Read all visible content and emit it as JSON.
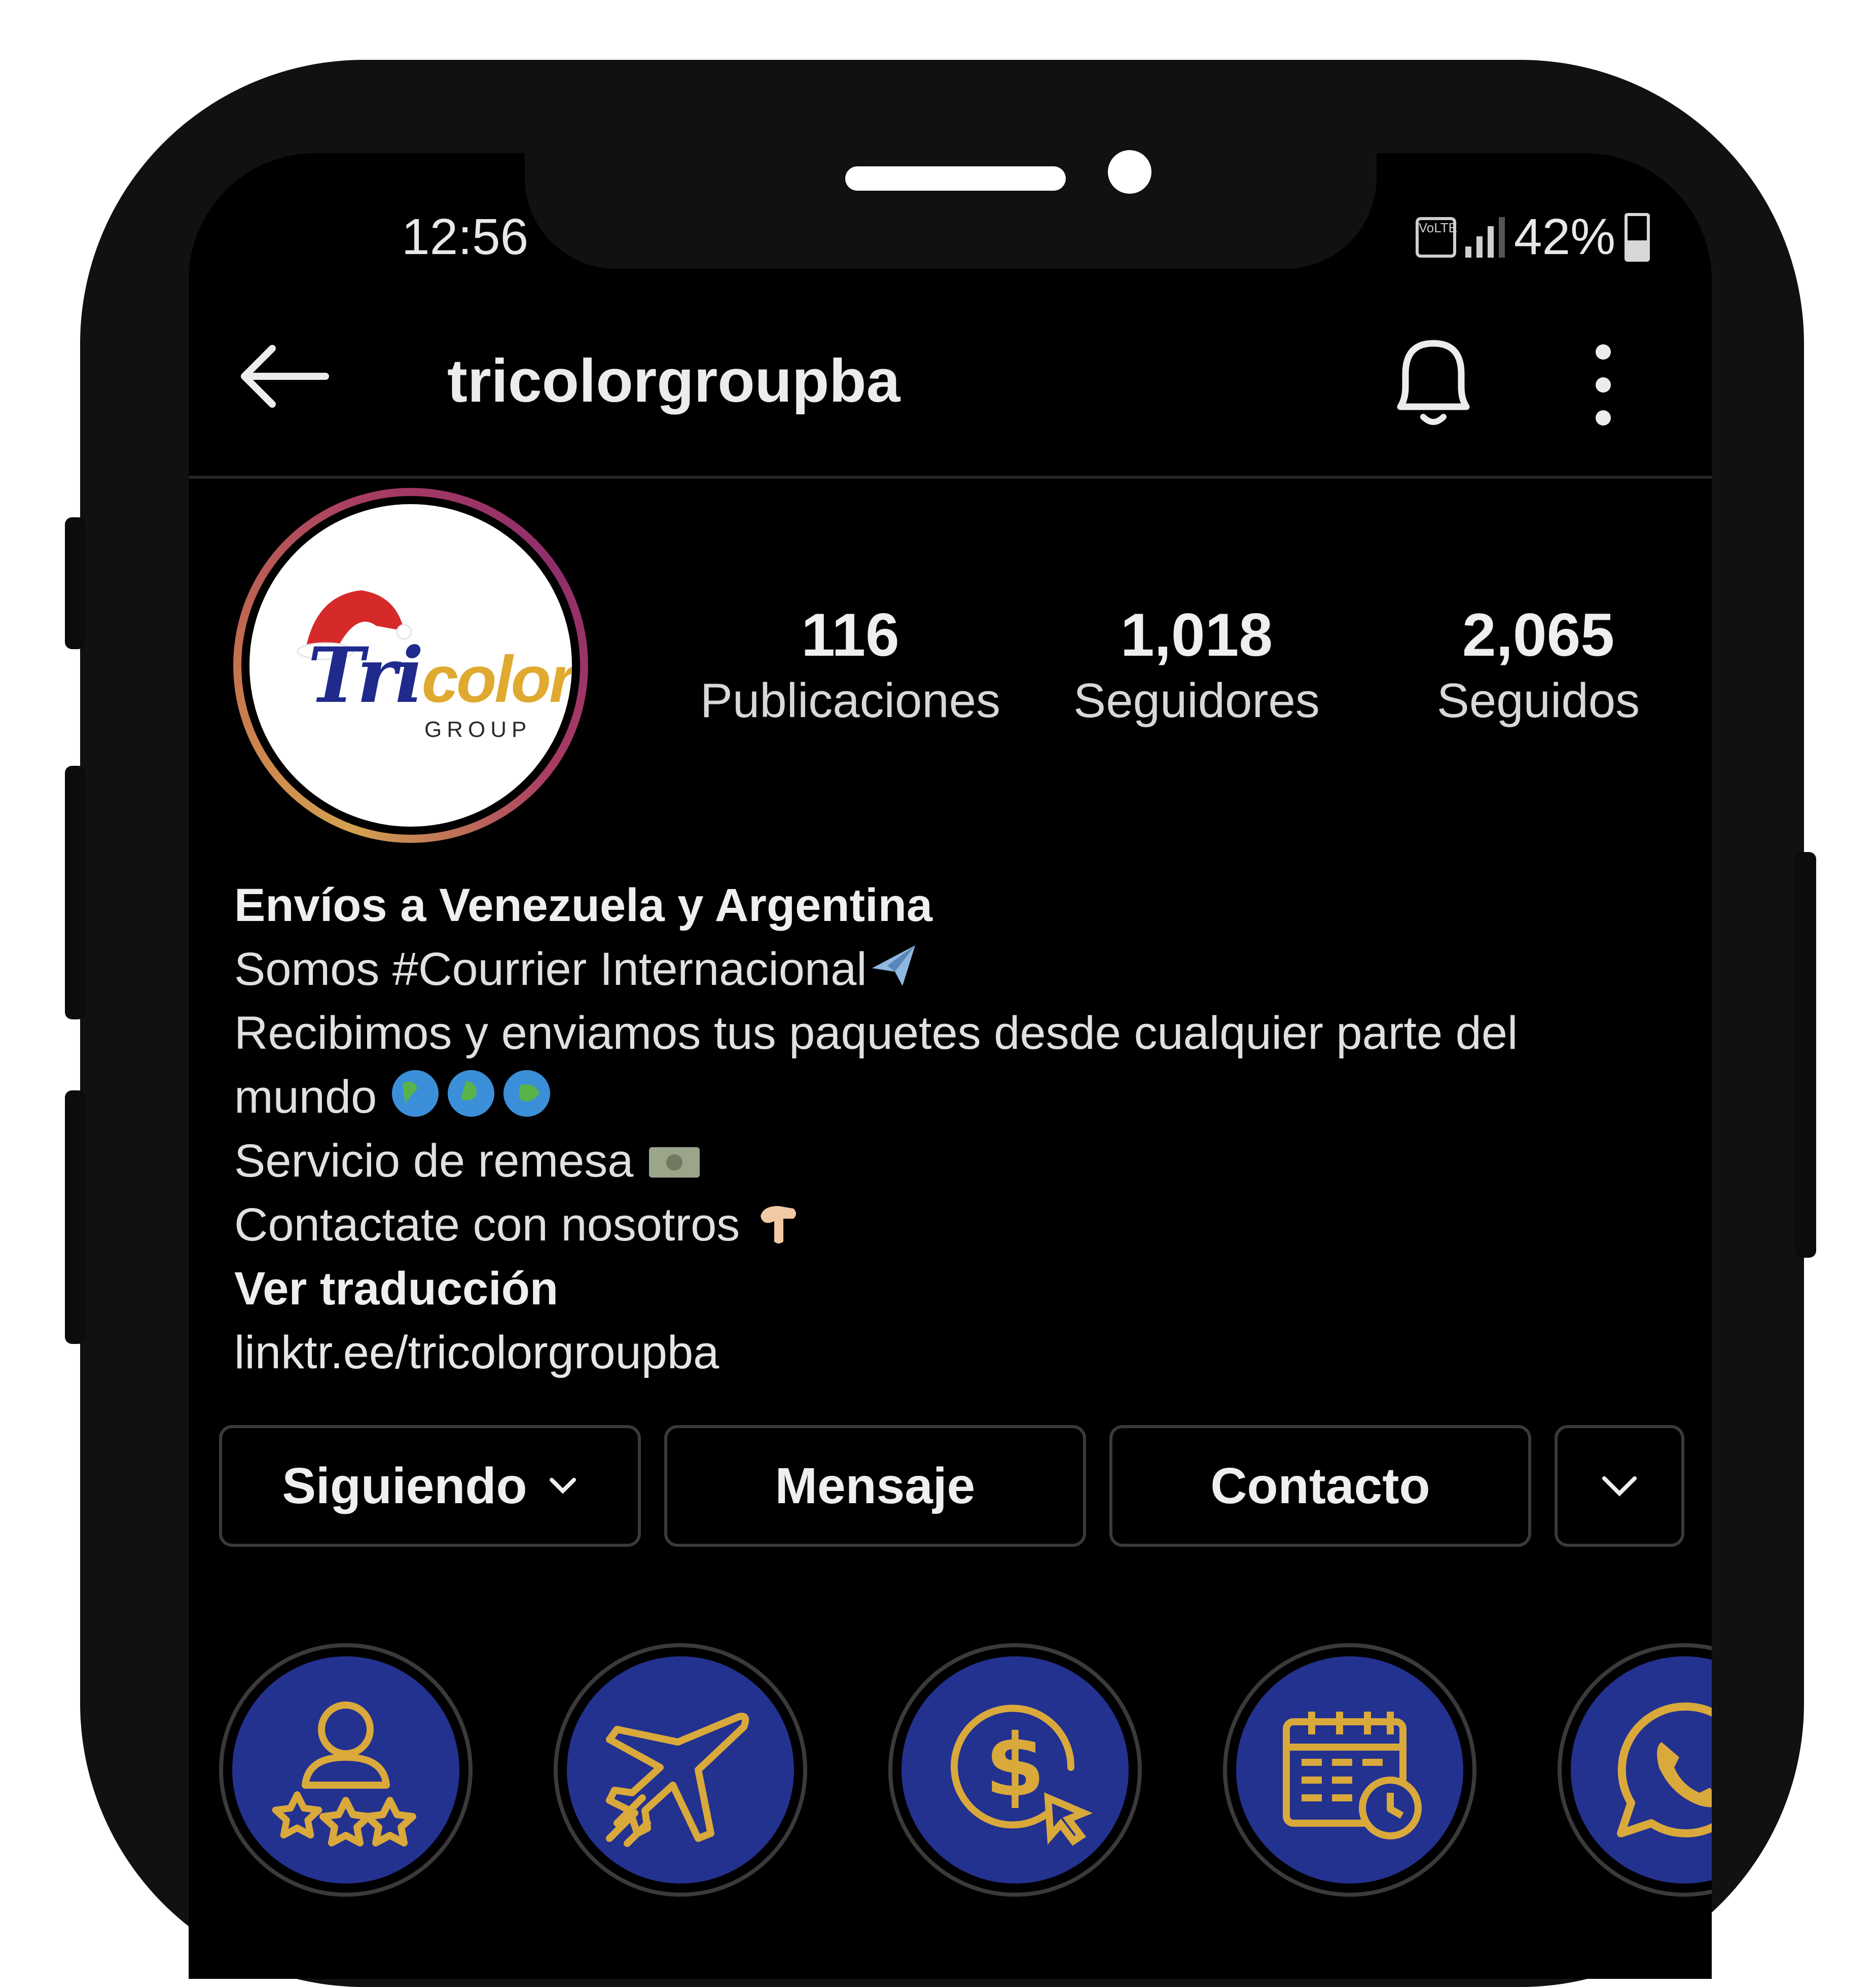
{
  "status_bar": {
    "time": "12:56",
    "network_label": "VoLTE",
    "battery": "42%",
    "battery_level": 0.42
  },
  "header": {
    "username": "tricolorgroupba"
  },
  "profile": {
    "logo_text": {
      "tri": "Tri",
      "color": "color",
      "group": "GROUP"
    },
    "stats": [
      {
        "value": "116",
        "label": "Publicaciones"
      },
      {
        "value": "1,018",
        "label": "Seguidores"
      },
      {
        "value": "2,065",
        "label": "Seguidos"
      }
    ]
  },
  "bio": {
    "title": "Envíos a Venezuela y Argentina",
    "line1": "Somos #Courrier Internacional",
    "line2": "Recibimos y enviamos tus paquetes desde cualquier parte del",
    "line3": "mundo",
    "line4": "Servicio de remesa",
    "line5": "Contactate con nosotros",
    "translate": "Ver traducción",
    "link": "linktr.ee/tricolorgroupba"
  },
  "actions": {
    "following": "Siguiendo",
    "message": "Mensaje",
    "contact": "Contacto"
  },
  "highlights": {
    "items": [
      {
        "icon": "user-rating-icon"
      },
      {
        "icon": "airplane-icon"
      },
      {
        "icon": "dollar-click-icon"
      },
      {
        "icon": "calendar-clock-icon"
      },
      {
        "icon": "whatsapp-icon"
      }
    ]
  },
  "colors": {
    "highlight_bg": "#23318f",
    "highlight_gold": "#d9a93b"
  }
}
